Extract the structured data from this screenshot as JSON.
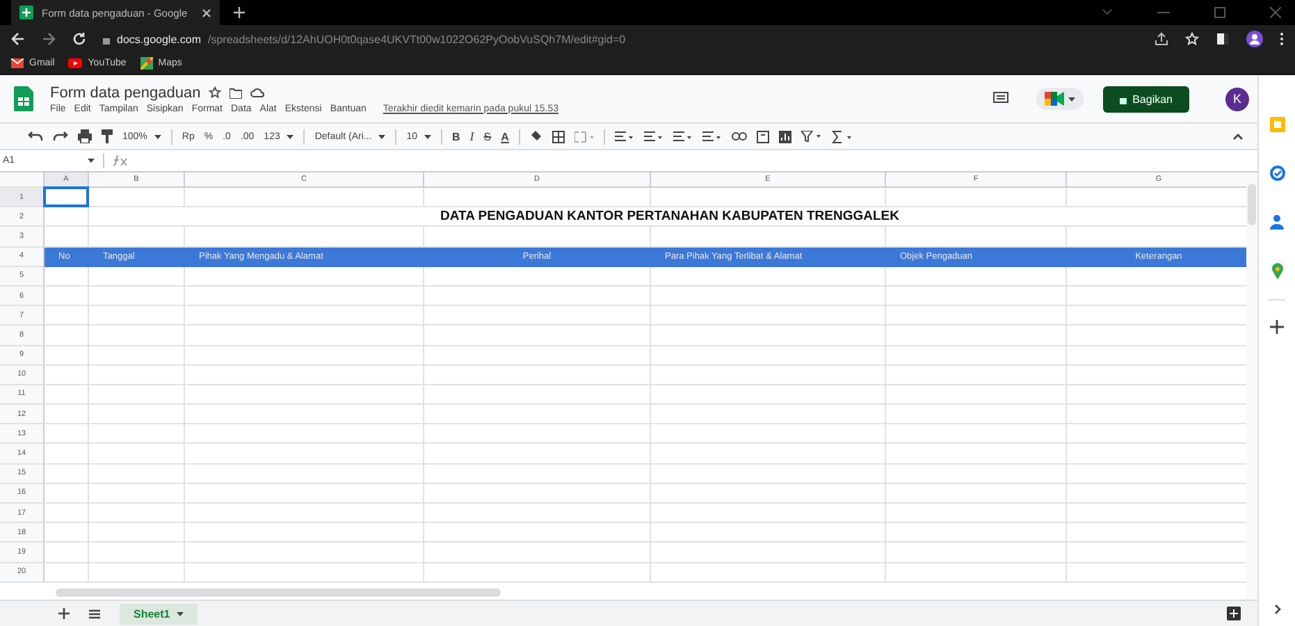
{
  "browser": {
    "tab_title": "Form data pengaduan - Google",
    "url_host": "docs.google.com",
    "url_path": "/spreadsheets/d/12AhUOH0t0qase4UKVTt00w1022O62PyOobVuSQh7M/edit#gid=0",
    "bookmarks": [
      "Gmail",
      "YouTube",
      "Maps"
    ]
  },
  "doc": {
    "title": "Form data pengaduan",
    "menus": [
      "File",
      "Edit",
      "Tampilan",
      "Sisipkan",
      "Format",
      "Data",
      "Alat",
      "Ekstensi",
      "Bantuan"
    ],
    "last_edit": "Terakhir diedit kemarin pada pukul 15.53",
    "share_button": "Bagikan",
    "avatar": "K"
  },
  "toolbar": [
    {
      "kind": "dropdown",
      "label": "100%"
    },
    {
      "kind": "sep"
    },
    {
      "kind": "text",
      "label": "Rp"
    },
    {
      "kind": "text",
      "label": "%"
    },
    {
      "kind": "text",
      "label": ".0"
    },
    {
      "kind": "text",
      "label": ".00"
    },
    {
      "kind": "dropdown",
      "label": "123"
    },
    {
      "kind": "sep"
    },
    {
      "kind": "dropdown",
      "label": "Default (Ari..."
    },
    {
      "kind": "sep"
    },
    {
      "kind": "dropdown",
      "label": "10"
    },
    {
      "kind": "sep"
    },
    {
      "kind": "bold",
      "label": "B"
    },
    {
      "kind": "italic",
      "label": "I"
    },
    {
      "kind": "strike",
      "label": "S"
    },
    {
      "kind": "underline",
      "label": "A"
    }
  ],
  "name_box": "A1",
  "columns": [
    {
      "label": "A",
      "selected": true
    },
    {
      "label": "B",
      "selected": false
    },
    {
      "label": "C",
      "selected": false
    },
    {
      "label": "D",
      "selected": false
    },
    {
      "label": "E",
      "selected": false
    },
    {
      "label": "F",
      "selected": false
    },
    {
      "label": "G",
      "selected": false
    }
  ],
  "rows": [
    {
      "label": "1",
      "selected": true
    },
    {
      "label": "2",
      "selected": false,
      "kind": "title",
      "text": "DATA PENGADUAN KANTOR PERTANAHAN KABUPATEN TRENGGALEK"
    },
    {
      "label": "3",
      "selected": false
    },
    {
      "label": "4",
      "selected": false,
      "kind": "header",
      "cells": [
        "No",
        "Tanggal",
        "Pihak Yang Mengadu & Alamat",
        "Perihal",
        "Para Pihak Yang Terlibat & Alamat",
        "Objek Pengaduan",
        "Keterangan"
      ]
    },
    {
      "label": "5",
      "selected": false
    },
    {
      "label": "6",
      "selected": false
    },
    {
      "label": "7",
      "selected": false
    },
    {
      "label": "8",
      "selected": false
    },
    {
      "label": "9",
      "selected": false
    },
    {
      "label": "10",
      "selected": false
    },
    {
      "label": "11",
      "selected": false
    },
    {
      "label": "12",
      "selected": false
    },
    {
      "label": "13",
      "selected": false
    },
    {
      "label": "14",
      "selected": false
    },
    {
      "label": "15",
      "selected": false
    },
    {
      "label": "16",
      "selected": false
    },
    {
      "label": "17",
      "selected": false
    },
    {
      "label": "18",
      "selected": false
    },
    {
      "label": "19",
      "selected": false
    },
    {
      "label": "20",
      "selected": false
    }
  ],
  "sheet_tabs": [
    {
      "label": "Sheet1",
      "selected": true
    }
  ]
}
